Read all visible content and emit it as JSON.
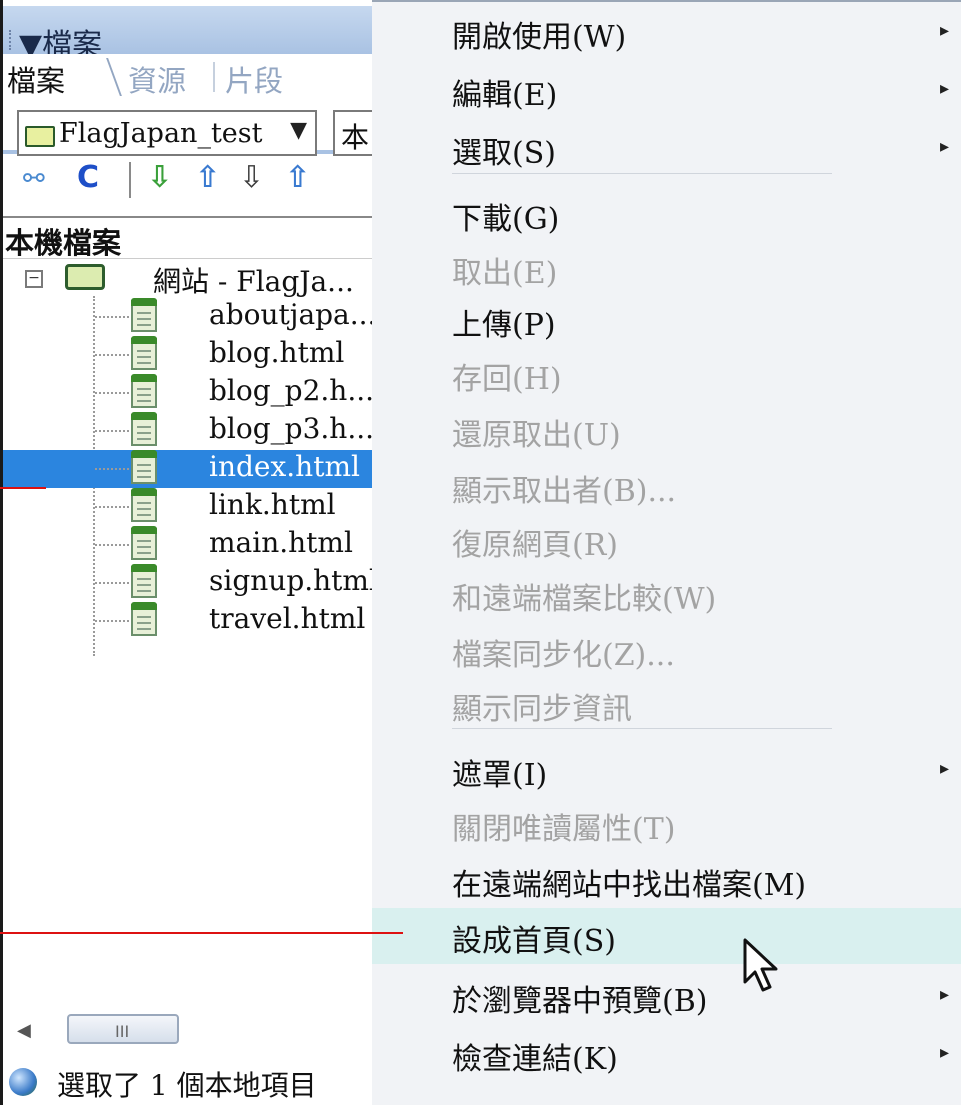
{
  "panel": {
    "title": "▼檔案",
    "tabs": [
      "檔案",
      "資源",
      "片段"
    ],
    "site_name": "FlagJapan_test",
    "view_select": "本",
    "local_files_label": "本機檔案",
    "root_label": "網站 - FlagJa...",
    "files": [
      {
        "name": "aboutjapa...",
        "selected": false
      },
      {
        "name": "blog.html",
        "selected": false
      },
      {
        "name": "blog_p2.h...",
        "selected": false
      },
      {
        "name": "blog_p3.h...",
        "selected": false
      },
      {
        "name": "index.html",
        "selected": true
      },
      {
        "name": "link.html",
        "selected": false
      },
      {
        "name": "main.html",
        "selected": false
      },
      {
        "name": "signup.html",
        "selected": false
      },
      {
        "name": "travel.html",
        "selected": false
      }
    ],
    "status": "選取了 1 個本地項目",
    "scroll_grip": "III"
  },
  "menu": {
    "items": [
      {
        "label": "開啟使用(W)",
        "disabled": false,
        "submenu": true
      },
      {
        "label": "編輯(E)",
        "disabled": false,
        "submenu": true
      },
      {
        "label": "選取(S)",
        "disabled": false,
        "submenu": true
      },
      {
        "label": "下載(G)",
        "disabled": false,
        "submenu": false
      },
      {
        "label": "取出(E)",
        "disabled": true,
        "submenu": false
      },
      {
        "label": "上傳(P)",
        "disabled": false,
        "submenu": false
      },
      {
        "label": "存回(H)",
        "disabled": true,
        "submenu": false
      },
      {
        "label": "還原取出(U)",
        "disabled": true,
        "submenu": false
      },
      {
        "label": "顯示取出者(B)...",
        "disabled": true,
        "submenu": false
      },
      {
        "label": "復原網頁(R)",
        "disabled": true,
        "submenu": false
      },
      {
        "label": "和遠端檔案比較(W)",
        "disabled": true,
        "submenu": false
      },
      {
        "label": "檔案同步化(Z)...",
        "disabled": true,
        "submenu": false
      },
      {
        "label": "顯示同步資訊",
        "disabled": true,
        "submenu": false
      },
      {
        "label": "遮罩(I)",
        "disabled": false,
        "submenu": true
      },
      {
        "label": "關閉唯讀屬性(T)",
        "disabled": true,
        "submenu": false
      },
      {
        "label": "在遠端網站中找出檔案(M)",
        "disabled": false,
        "submenu": false
      },
      {
        "label": "設成首頁(S)",
        "disabled": false,
        "submenu": false,
        "hover": true
      },
      {
        "label": "於瀏覽器中預覽(B)",
        "disabled": false,
        "submenu": true
      },
      {
        "label": "檢查連結(K)",
        "disabled": false,
        "submenu": true
      }
    ],
    "submenu_arrow": "▸"
  }
}
